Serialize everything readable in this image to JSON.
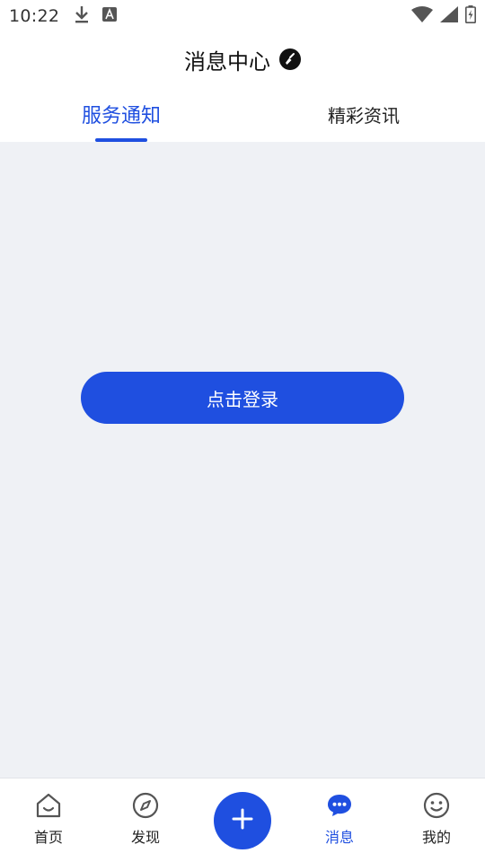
{
  "status_bar": {
    "time": "10:22",
    "icons": [
      "download-icon",
      "a-notification-icon",
      "wifi-icon",
      "cellular-signal-icon",
      "battery-icon"
    ]
  },
  "header": {
    "title": "消息中心",
    "action_icon": "broom-clean-icon"
  },
  "tabs": [
    {
      "label": "服务通知",
      "active": true
    },
    {
      "label": "精彩资讯",
      "active": false
    }
  ],
  "content": {
    "login_button_label": "点击登录"
  },
  "bottom_nav": {
    "items": [
      {
        "label": "首页",
        "icon": "home-icon",
        "active": false
      },
      {
        "label": "发现",
        "icon": "compass-icon",
        "active": false
      },
      {
        "label": "",
        "icon": "plus-icon",
        "active": false
      },
      {
        "label": "消息",
        "icon": "chat-bubble-icon",
        "active": true
      },
      {
        "label": "我的",
        "icon": "smiley-face-icon",
        "active": false
      }
    ]
  },
  "colors": {
    "accent": "#1f4fe0",
    "content_bg": "#eff1f5",
    "text": "#222222"
  }
}
